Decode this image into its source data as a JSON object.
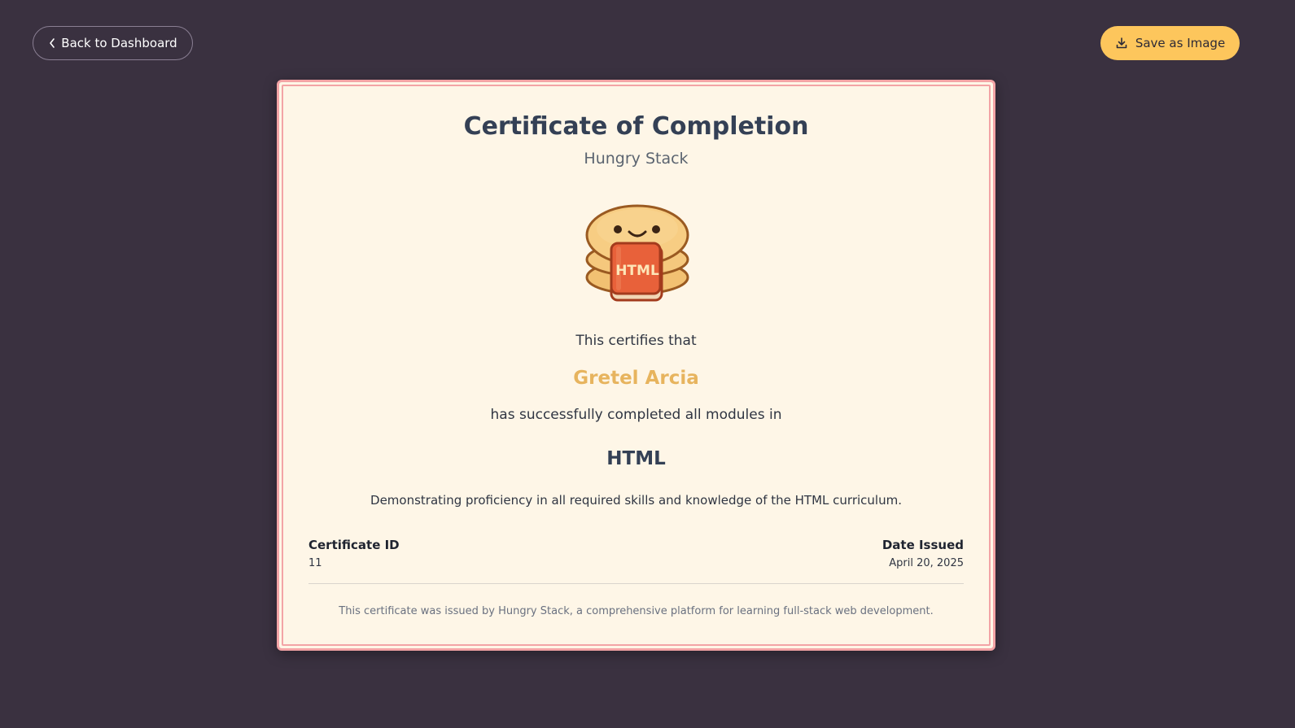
{
  "nav": {
    "back_label": "Back to Dashboard",
    "save_label": "Save as Image"
  },
  "certificate": {
    "title": "Certificate of Completion",
    "organization": "Hungry Stack",
    "certifies_text": "This certifies that",
    "recipient_name": "Gretel Arcia",
    "completed_text": "has successfully completed all modules in",
    "course": "HTML",
    "description": "Demonstrating proficiency in all required skills and knowledge of the HTML curriculum.",
    "certificate_id_label": "Certificate ID",
    "certificate_id": "11",
    "date_label": "Date Issued",
    "date_issued": "April 20, 2025",
    "footer_note": "This certificate was issued by Hungry Stack, a comprehensive platform for learning full-stack web development.",
    "mascot_book_label": "HTML"
  },
  "colors": {
    "background": "#3a3140",
    "certificate_bg": "#fef6e7",
    "border": "#f3a4a6",
    "accent": "#fdc65c",
    "recipient": "#e7b45e",
    "book": "#e8613a"
  },
  "icons": {
    "back": "chevron-left-icon",
    "save": "download-icon",
    "mascot": "pancake-mascot-icon"
  }
}
